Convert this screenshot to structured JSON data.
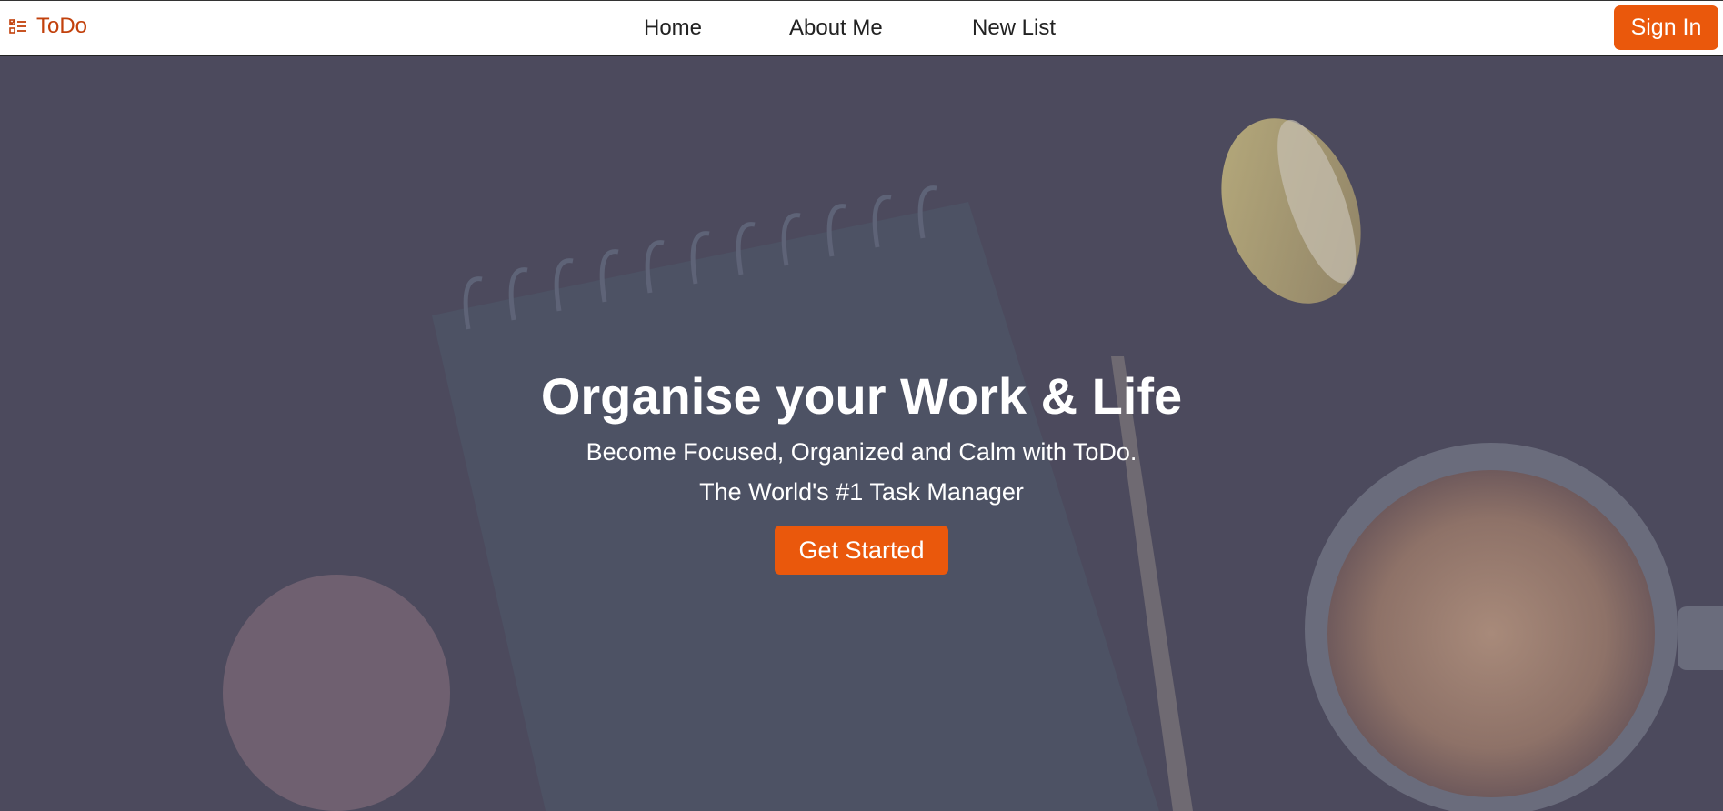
{
  "navbar": {
    "brand": "ToDo",
    "links": [
      "Home",
      "About Me",
      "New List"
    ],
    "signin_label": "Sign In",
    "accent": "#ea580c"
  },
  "hero": {
    "title": "Organise your Work & Life",
    "subtitle": "Become Focused, Organized and Calm with ToDo.",
    "tagline": "The World's #1 Task Manager",
    "cta_label": "Get Started",
    "background_image": "notebook-pencil-macarons-coffee"
  }
}
